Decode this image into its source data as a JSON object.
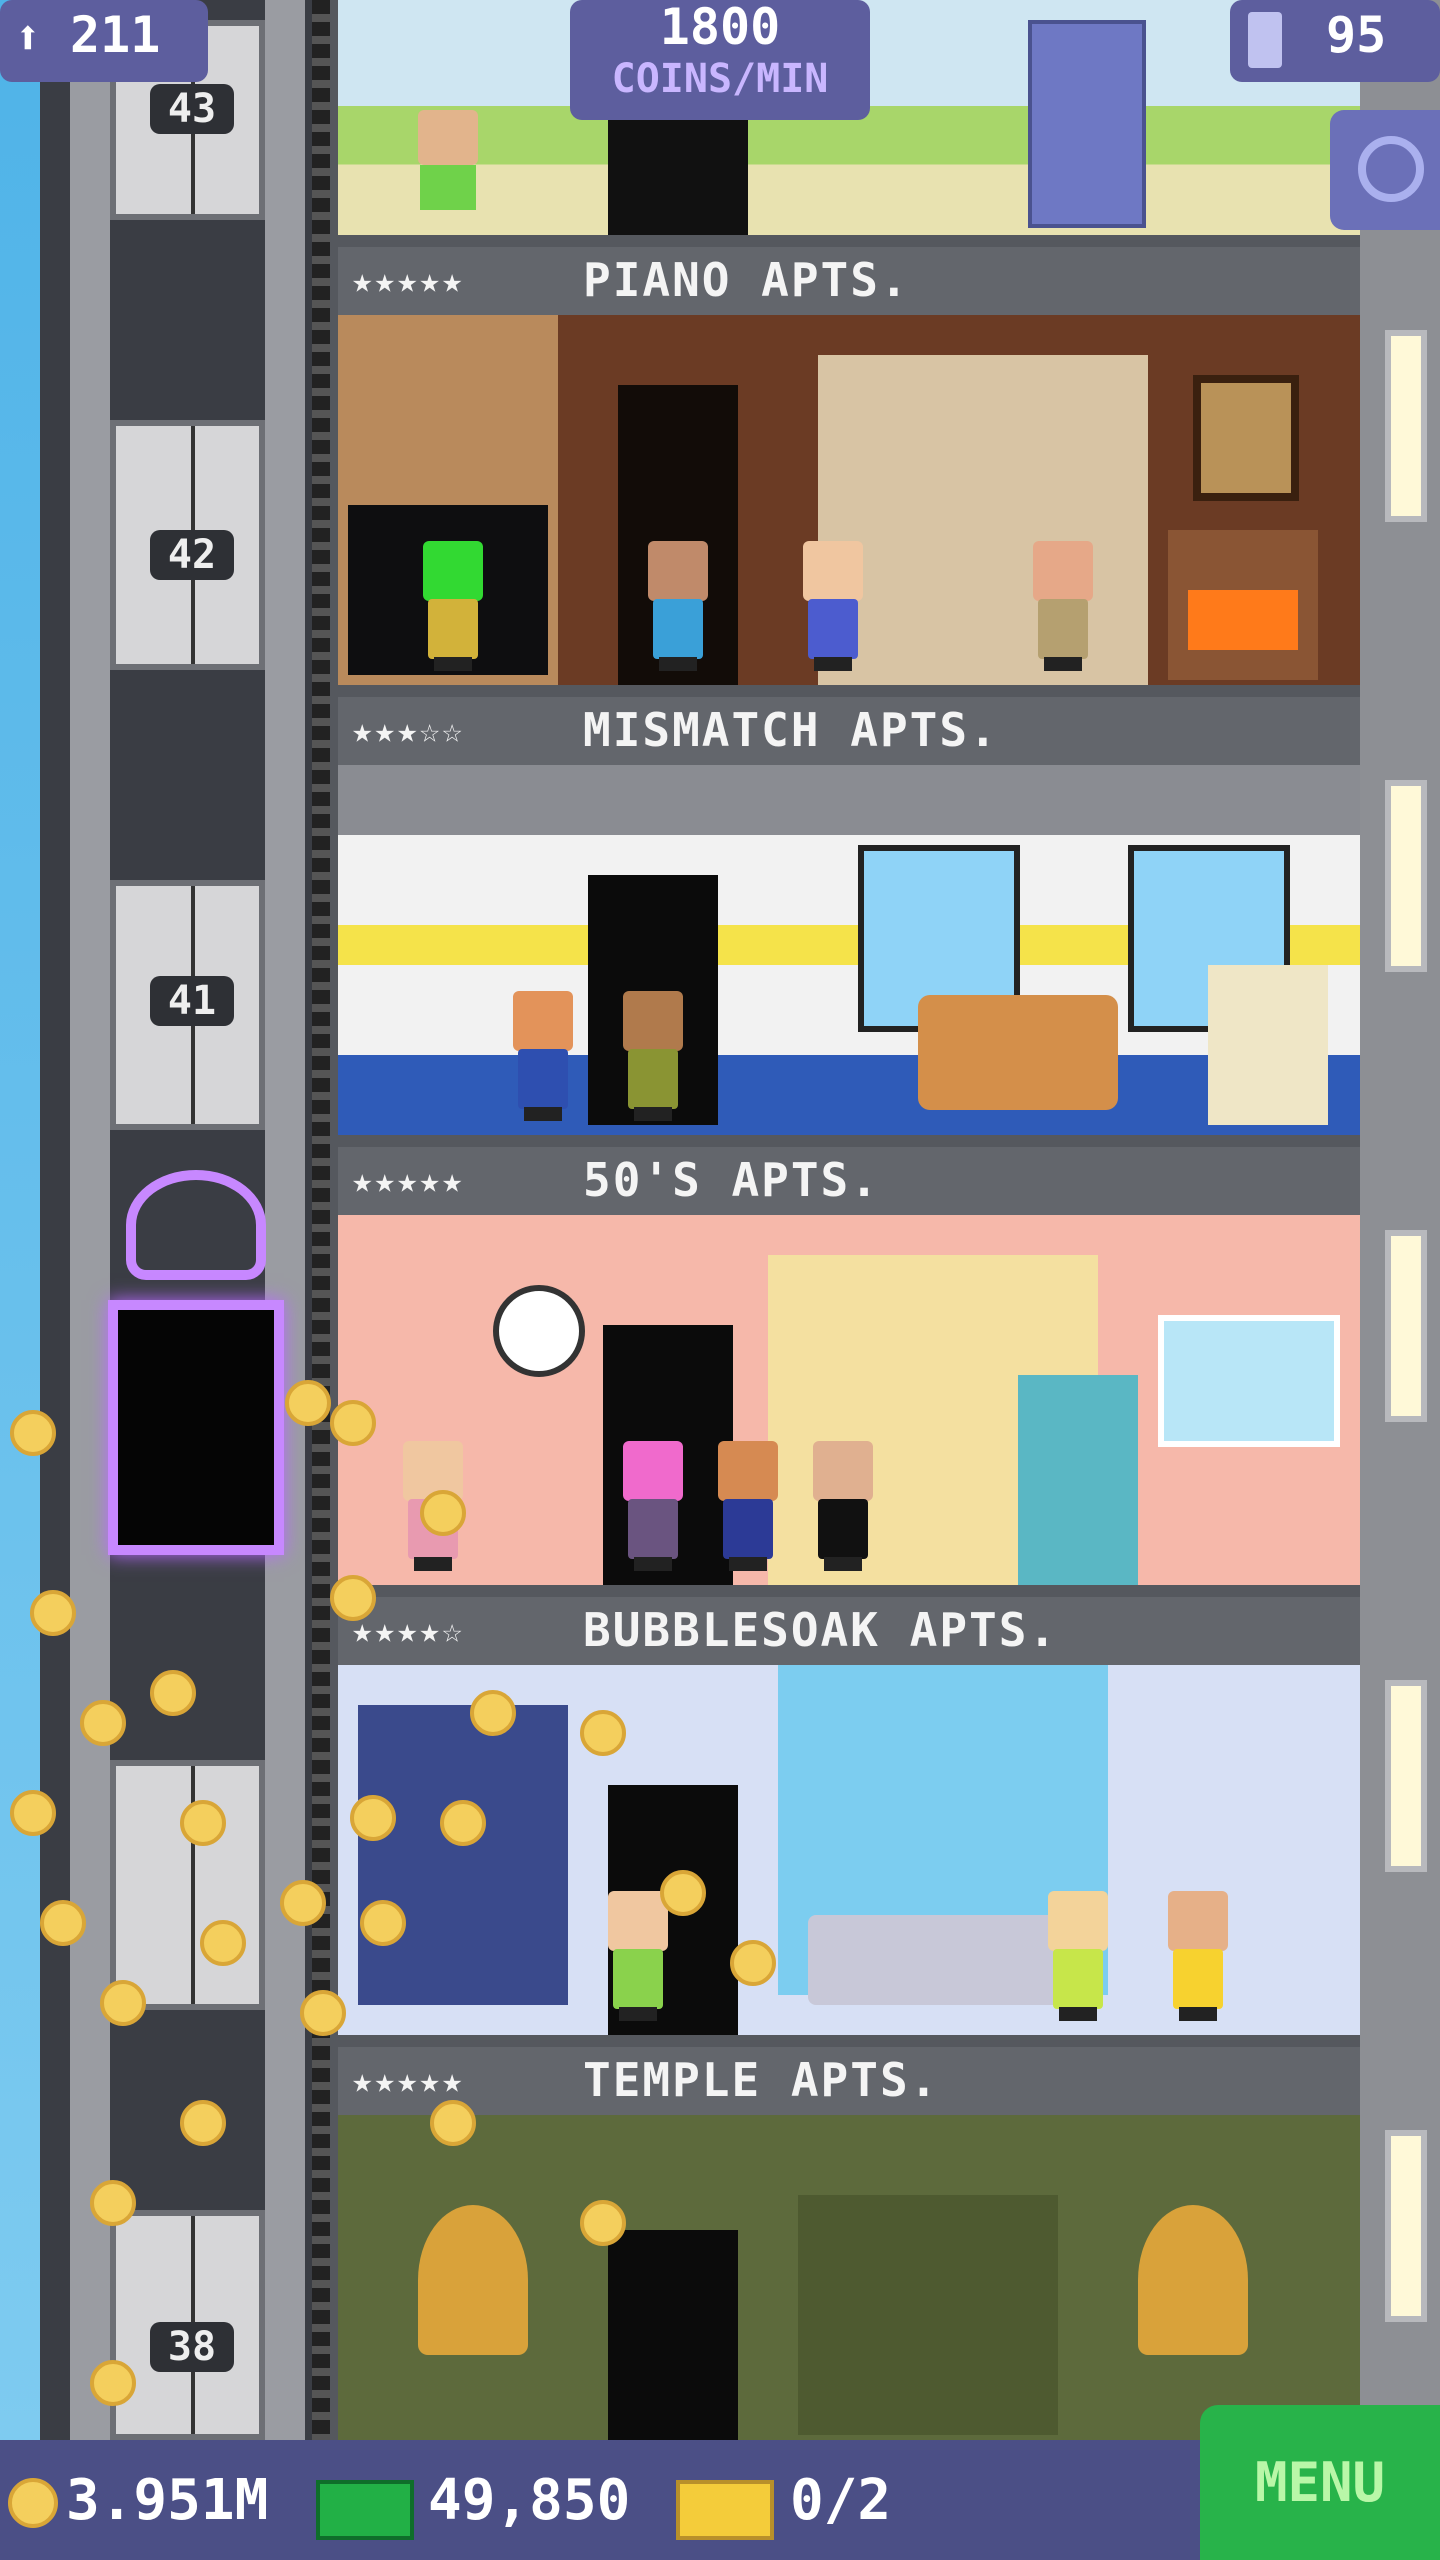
{
  "hud": {
    "population": "211",
    "coins_rate_value": "1800",
    "coins_rate_unit": "COINS/MIN",
    "floors": "95"
  },
  "elevator": {
    "floor_numbers": [
      "43",
      "42",
      "41",
      "38"
    ]
  },
  "floors": [
    {
      "name": "PIANO APTS.",
      "stars": "★★★★★",
      "wall": "#6b3b24",
      "accent": "#c79a64"
    },
    {
      "name": "MISMATCH APTS.",
      "stars": "★★★☆☆",
      "wall": "#f2f2f2",
      "accent": "#f5e34a"
    },
    {
      "name": "50'S APTS.",
      "stars": "★★★★★",
      "wall": "#f6b8aa",
      "accent": "#f4e0a0"
    },
    {
      "name": "BUBBLESOAK APTS.",
      "stars": "★★★★☆",
      "wall": "#d7e0f5",
      "accent": "#7ccdf0"
    },
    {
      "name": "TEMPLE APTS.",
      "stars": "★★★★★",
      "wall": "#5d6a3c",
      "accent": "#3d4526"
    }
  ],
  "bottom": {
    "coins": "3.951M",
    "bux": "49,850",
    "tickets": "0/2",
    "menu_label": "MENU"
  },
  "colors": {
    "hud_bg": "#5d5e9e",
    "menu_bg": "#28b34a",
    "neon": "#c788ff",
    "coin": "#f4cf5d"
  }
}
